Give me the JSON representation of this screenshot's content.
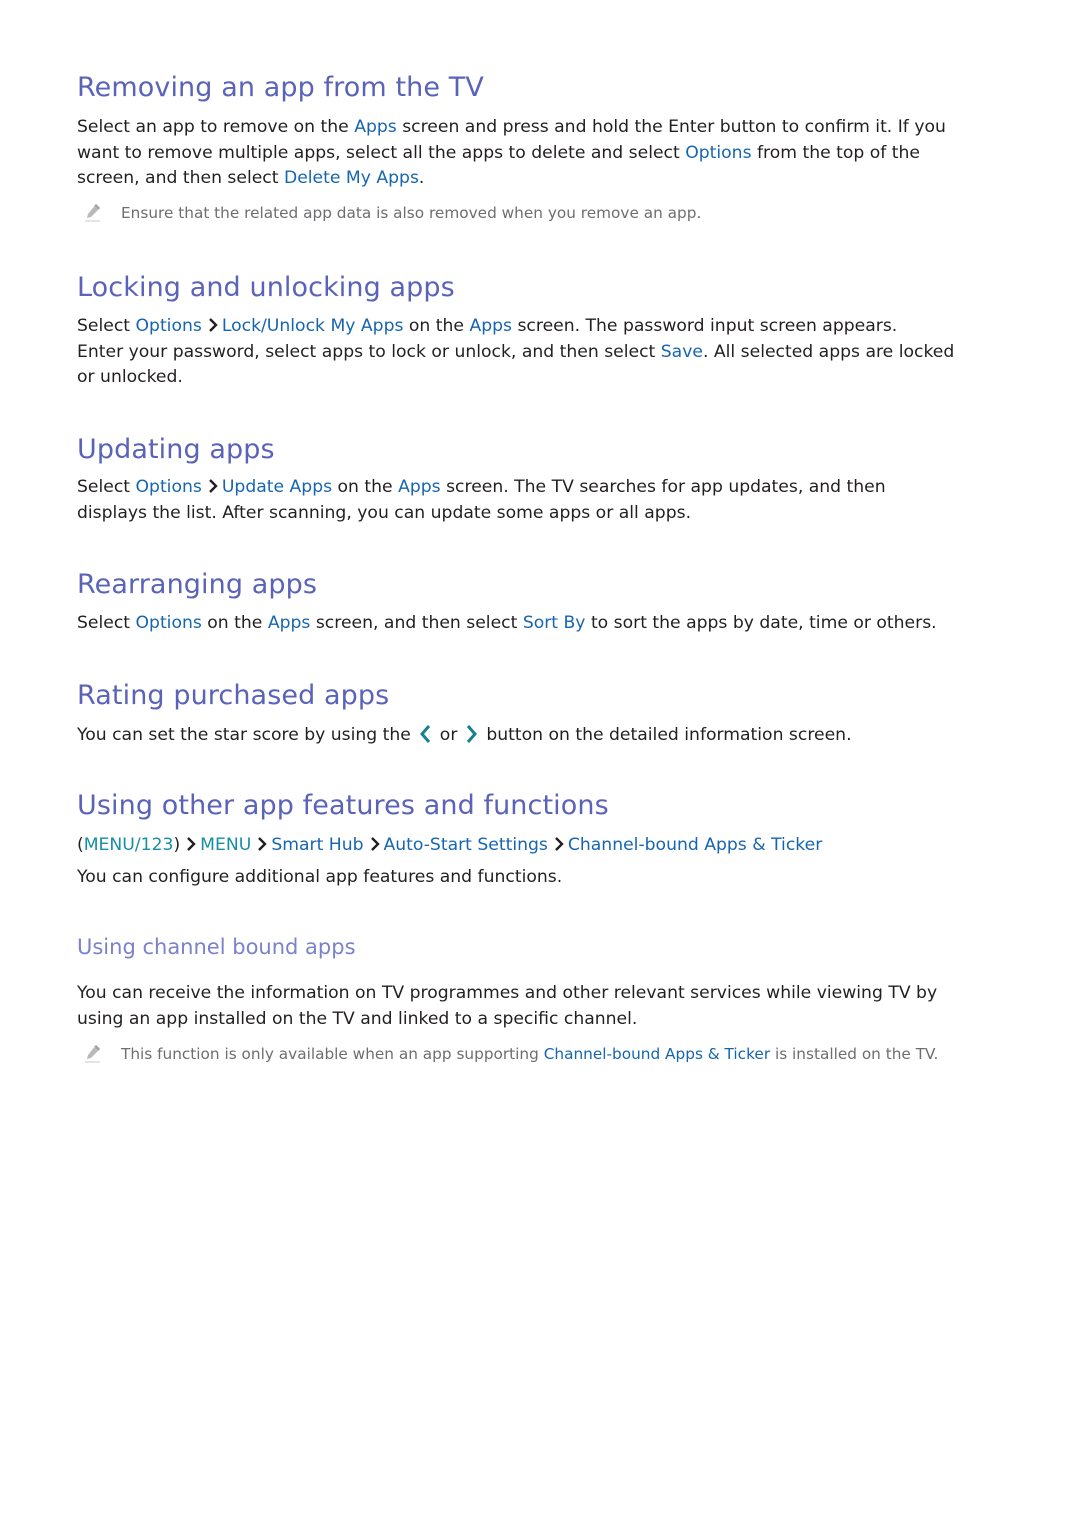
{
  "colors": {
    "heading": "#5a63b8",
    "subheading": "#7b82c8",
    "body_text": "#231f20",
    "link": "#1665b0",
    "menu_link": "#168ea3",
    "note_text": "#6d6e71",
    "nav_arrow": "#16808f"
  },
  "sections": {
    "removing": {
      "title": "Removing an app from the TV",
      "p1": {
        "t1": "Select an app to remove on the ",
        "l1": "Apps",
        "t2": " screen and press and hold the Enter button to confirm it. If you",
        "t3": "want to remove multiple apps, select all the apps to delete and select ",
        "l2": "Options",
        "t4": " from the top of the",
        "t5": "screen, and then select ",
        "l3": "Delete My Apps",
        "t6": "."
      },
      "note": "Ensure that the related app data is also removed when you remove an app."
    },
    "locking": {
      "title": "Locking and unlocking apps",
      "p1": {
        "t1": "Select ",
        "l1": "Options",
        "l2": "Lock/Unlock My Apps",
        "t2": " on the ",
        "l3": "Apps",
        "t3": " screen. The password input screen appears.",
        "t4": "Enter your password, select apps to lock or unlock, and then select ",
        "l4": "Save",
        "t5": ". All selected apps are locked",
        "t6": "or unlocked."
      }
    },
    "updating": {
      "title": "Updating apps",
      "p1": {
        "t1": "Select ",
        "l1": "Options",
        "l2": "Update Apps",
        "t2": " on the ",
        "l3": "Apps",
        "t3": " screen. The TV searches for app updates, and then",
        "t4": "displays the list. After scanning, you can update some apps or all apps."
      }
    },
    "rearranging": {
      "title": "Rearranging apps",
      "p1": {
        "t1": "Select ",
        "l1": "Options",
        "t2": " on the ",
        "l2": "Apps",
        "t3": " screen, and then select ",
        "l3": "Sort By",
        "t4": " to sort the apps by date, time or others."
      }
    },
    "rating": {
      "title": "Rating purchased apps",
      "p1": {
        "t1": "You can set the star score by using the ",
        "t2": " or ",
        "t3": " button on the detailed information screen."
      }
    },
    "other": {
      "title": "Using other app features and functions",
      "breadcrumb": {
        "open_paren": "(",
        "menu123": "MENU/123",
        "close_paren": ")",
        "menu": "MENU",
        "smart_hub": "Smart Hub",
        "auto_start": "Auto-Start Settings",
        "channel_bound": "Channel-bound Apps & Ticker"
      },
      "p1": "You can configure additional app features and functions.",
      "subsection": {
        "title": "Using channel bound apps",
        "p1": {
          "t1": "You can receive the information on TV programmes and other relevant services while viewing TV by",
          "t2": "using an app installed on the TV and linked to a specific channel."
        },
        "note": {
          "t1": "This function is only available when an app supporting ",
          "l1": "Channel-bound Apps & Ticker",
          "t2": " is installed on the TV."
        }
      }
    }
  },
  "icons": {
    "note": "pencil-icon",
    "breadcrumb_separator": "chevron-right-icon",
    "nav_left": "chevron-left-icon",
    "nav_right": "chevron-right-icon"
  }
}
